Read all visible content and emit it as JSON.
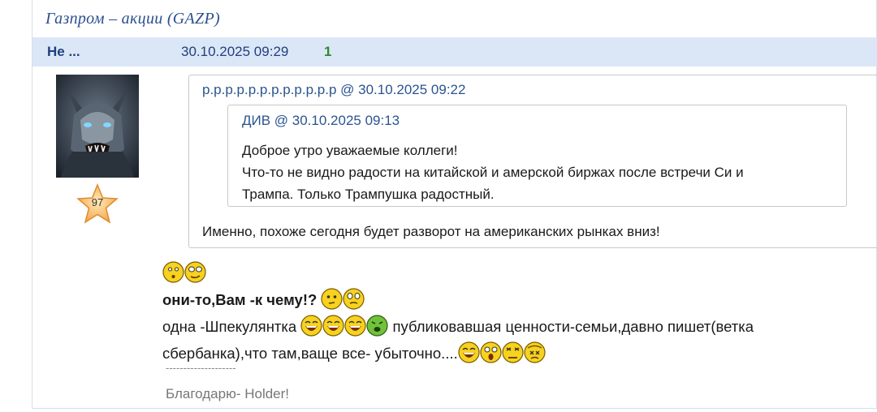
{
  "topic": {
    "title": "Газпром – акции (GAZP)"
  },
  "post": {
    "author": "Не ...",
    "date": "30.10.2025 09:29",
    "number": "1",
    "rating": "97",
    "quote": {
      "header": "р.р.р.р.р.р.р.р.р.р.р.р @ 30.10.2025 09:22",
      "nested": {
        "header": "ДИВ @ 30.10.2025 09:13",
        "lines": [
          "Доброе утро уважаемые коллеги!",
          "Что-то не видно радости на китайской и амерской биржах после встречи Си и",
          "Трампа. Только Трампушка радостный."
        ]
      },
      "text": "Именно, похоже сегодня будет разворот на американских рынках вниз!"
    },
    "body": {
      "line1": "они-то,Вам -к чему!?",
      "line2_a": "одна -Шпекулянтка",
      "line2_b": "публиковавшая ценности-семьи,давно пишет(ветка",
      "line3": "сбербанка),что там,ваще все- убыточно...."
    },
    "signature": {
      "divider": "--------------------",
      "text": "Благодарю- Holder!"
    }
  },
  "colors": {
    "header_bg": "#dbe7f6",
    "link": "#2a5590",
    "number": "#2e8b2e"
  }
}
